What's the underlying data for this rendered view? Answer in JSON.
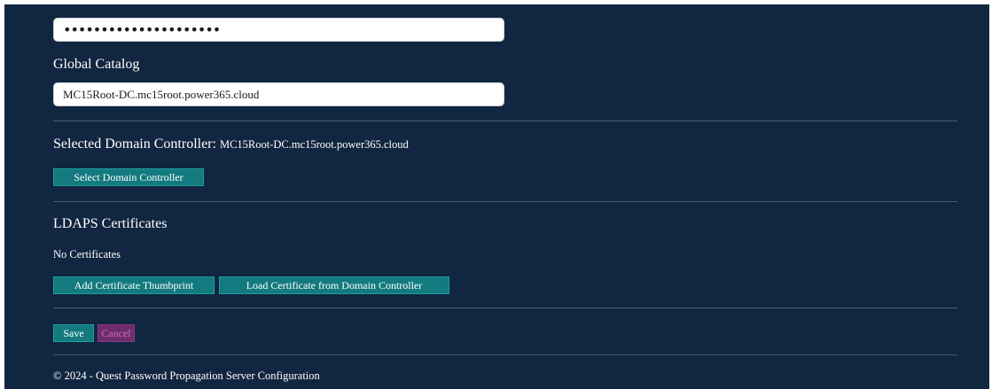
{
  "password": {
    "value": "•••••••••••••••••••••"
  },
  "global_catalog": {
    "label": "Global Catalog",
    "value": "MC15Root-DC.mc15root.power365.cloud"
  },
  "domain_controller": {
    "label": "Selected Domain Controller:",
    "value": "MC15Root-DC.mc15root.power365.cloud",
    "select_button": "Select Domain Controller"
  },
  "ldaps": {
    "title": "LDAPS Certificates",
    "status": "No Certificates",
    "add_button": "Add Certificate Thumbprint",
    "load_button": "Load Certificate from Domain Controller"
  },
  "actions": {
    "save": "Save",
    "cancel": "Cancel"
  },
  "footer": {
    "text": "© 2024 - Quest Password Propagation Server Configuration"
  },
  "colors": {
    "background": "#112640",
    "button_primary": "#137a7f",
    "button_cancel": "#6f2c6b"
  }
}
